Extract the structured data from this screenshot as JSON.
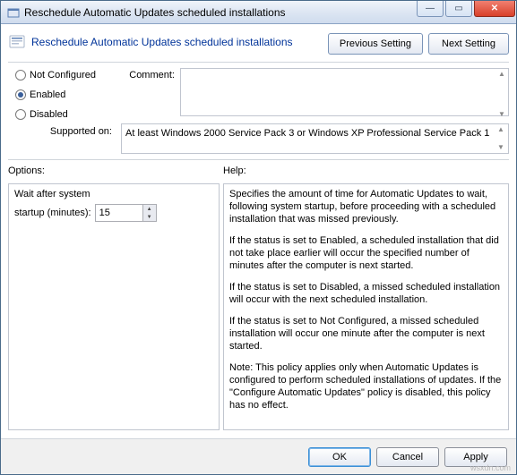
{
  "window": {
    "title": "Reschedule Automatic Updates scheduled installations"
  },
  "header": {
    "title": "Reschedule Automatic Updates scheduled installations",
    "previous": "Previous Setting",
    "next": "Next Setting"
  },
  "state_options": {
    "not_configured": "Not Configured",
    "enabled": "Enabled",
    "disabled": "Disabled",
    "selected": "enabled"
  },
  "comment": {
    "label": "Comment:",
    "value": ""
  },
  "supported": {
    "label": "Supported on:",
    "text": "At least Windows 2000 Service Pack 3 or Windows XP Professional Service Pack 1"
  },
  "options": {
    "panel_label": "Options:",
    "line1": "Wait after system",
    "line2": "startup (minutes):",
    "value": "15"
  },
  "help": {
    "panel_label": "Help:",
    "p1": "Specifies the amount of time for Automatic Updates to wait, following system startup, before proceeding with a scheduled installation that was missed previously.",
    "p2": "If the status is set to Enabled, a scheduled installation that did not take place earlier will occur the specified number of minutes after the computer is next started.",
    "p3": "If the status is set to Disabled, a missed scheduled installation will occur with the next scheduled installation.",
    "p4": "If the status is set to Not Configured, a missed scheduled installation will occur one minute after the computer is next started.",
    "p5": "Note: This policy applies only when Automatic Updates is configured to perform scheduled installations of updates. If the \"Configure Automatic Updates\" policy is disabled, this policy has no effect."
  },
  "footer": {
    "ok": "OK",
    "cancel": "Cancel",
    "apply": "Apply"
  },
  "watermark": "wsxdn.com"
}
